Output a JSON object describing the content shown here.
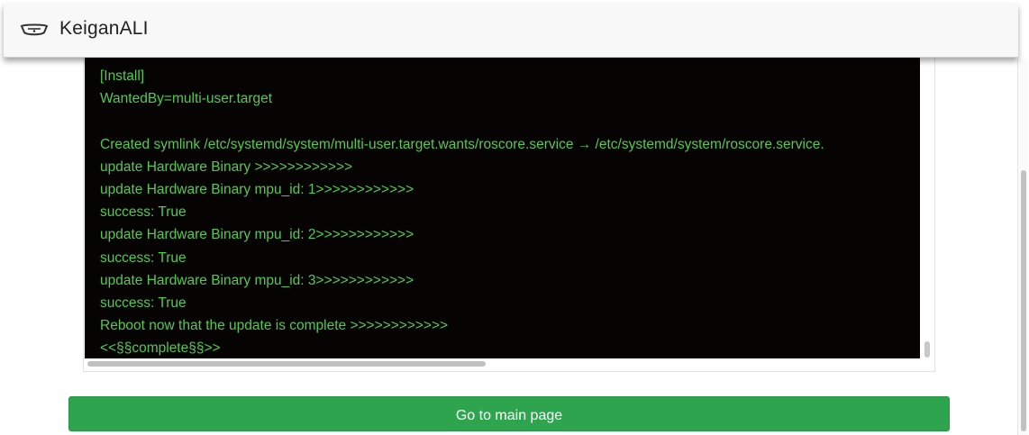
{
  "header": {
    "logo_icon": "car-outline-icon",
    "title": "KeiganALI"
  },
  "terminal": {
    "text_color": "#56c94f",
    "background": "#060303",
    "lines": [
      "[Install]",
      "WantedBy=multi-user.target",
      "",
      "Created symlink /etc/systemd/system/multi-user.target.wants/roscore.service → /etc/systemd/system/roscore.service.",
      "update Hardware Binary >>>>>>>>>>>>",
      "update Hardware Binary mpu_id: 1>>>>>>>>>>>>",
      "success: True",
      "update Hardware Binary mpu_id: 2>>>>>>>>>>>>",
      "success: True",
      "update Hardware Binary mpu_id: 3>>>>>>>>>>>>",
      "success: True",
      "Reboot now that the update is complete >>>>>>>>>>>>",
      "<<§§complete§§>>"
    ]
  },
  "actions": {
    "main_page_label": "Go to main page",
    "button_color": "#2ea44f"
  }
}
